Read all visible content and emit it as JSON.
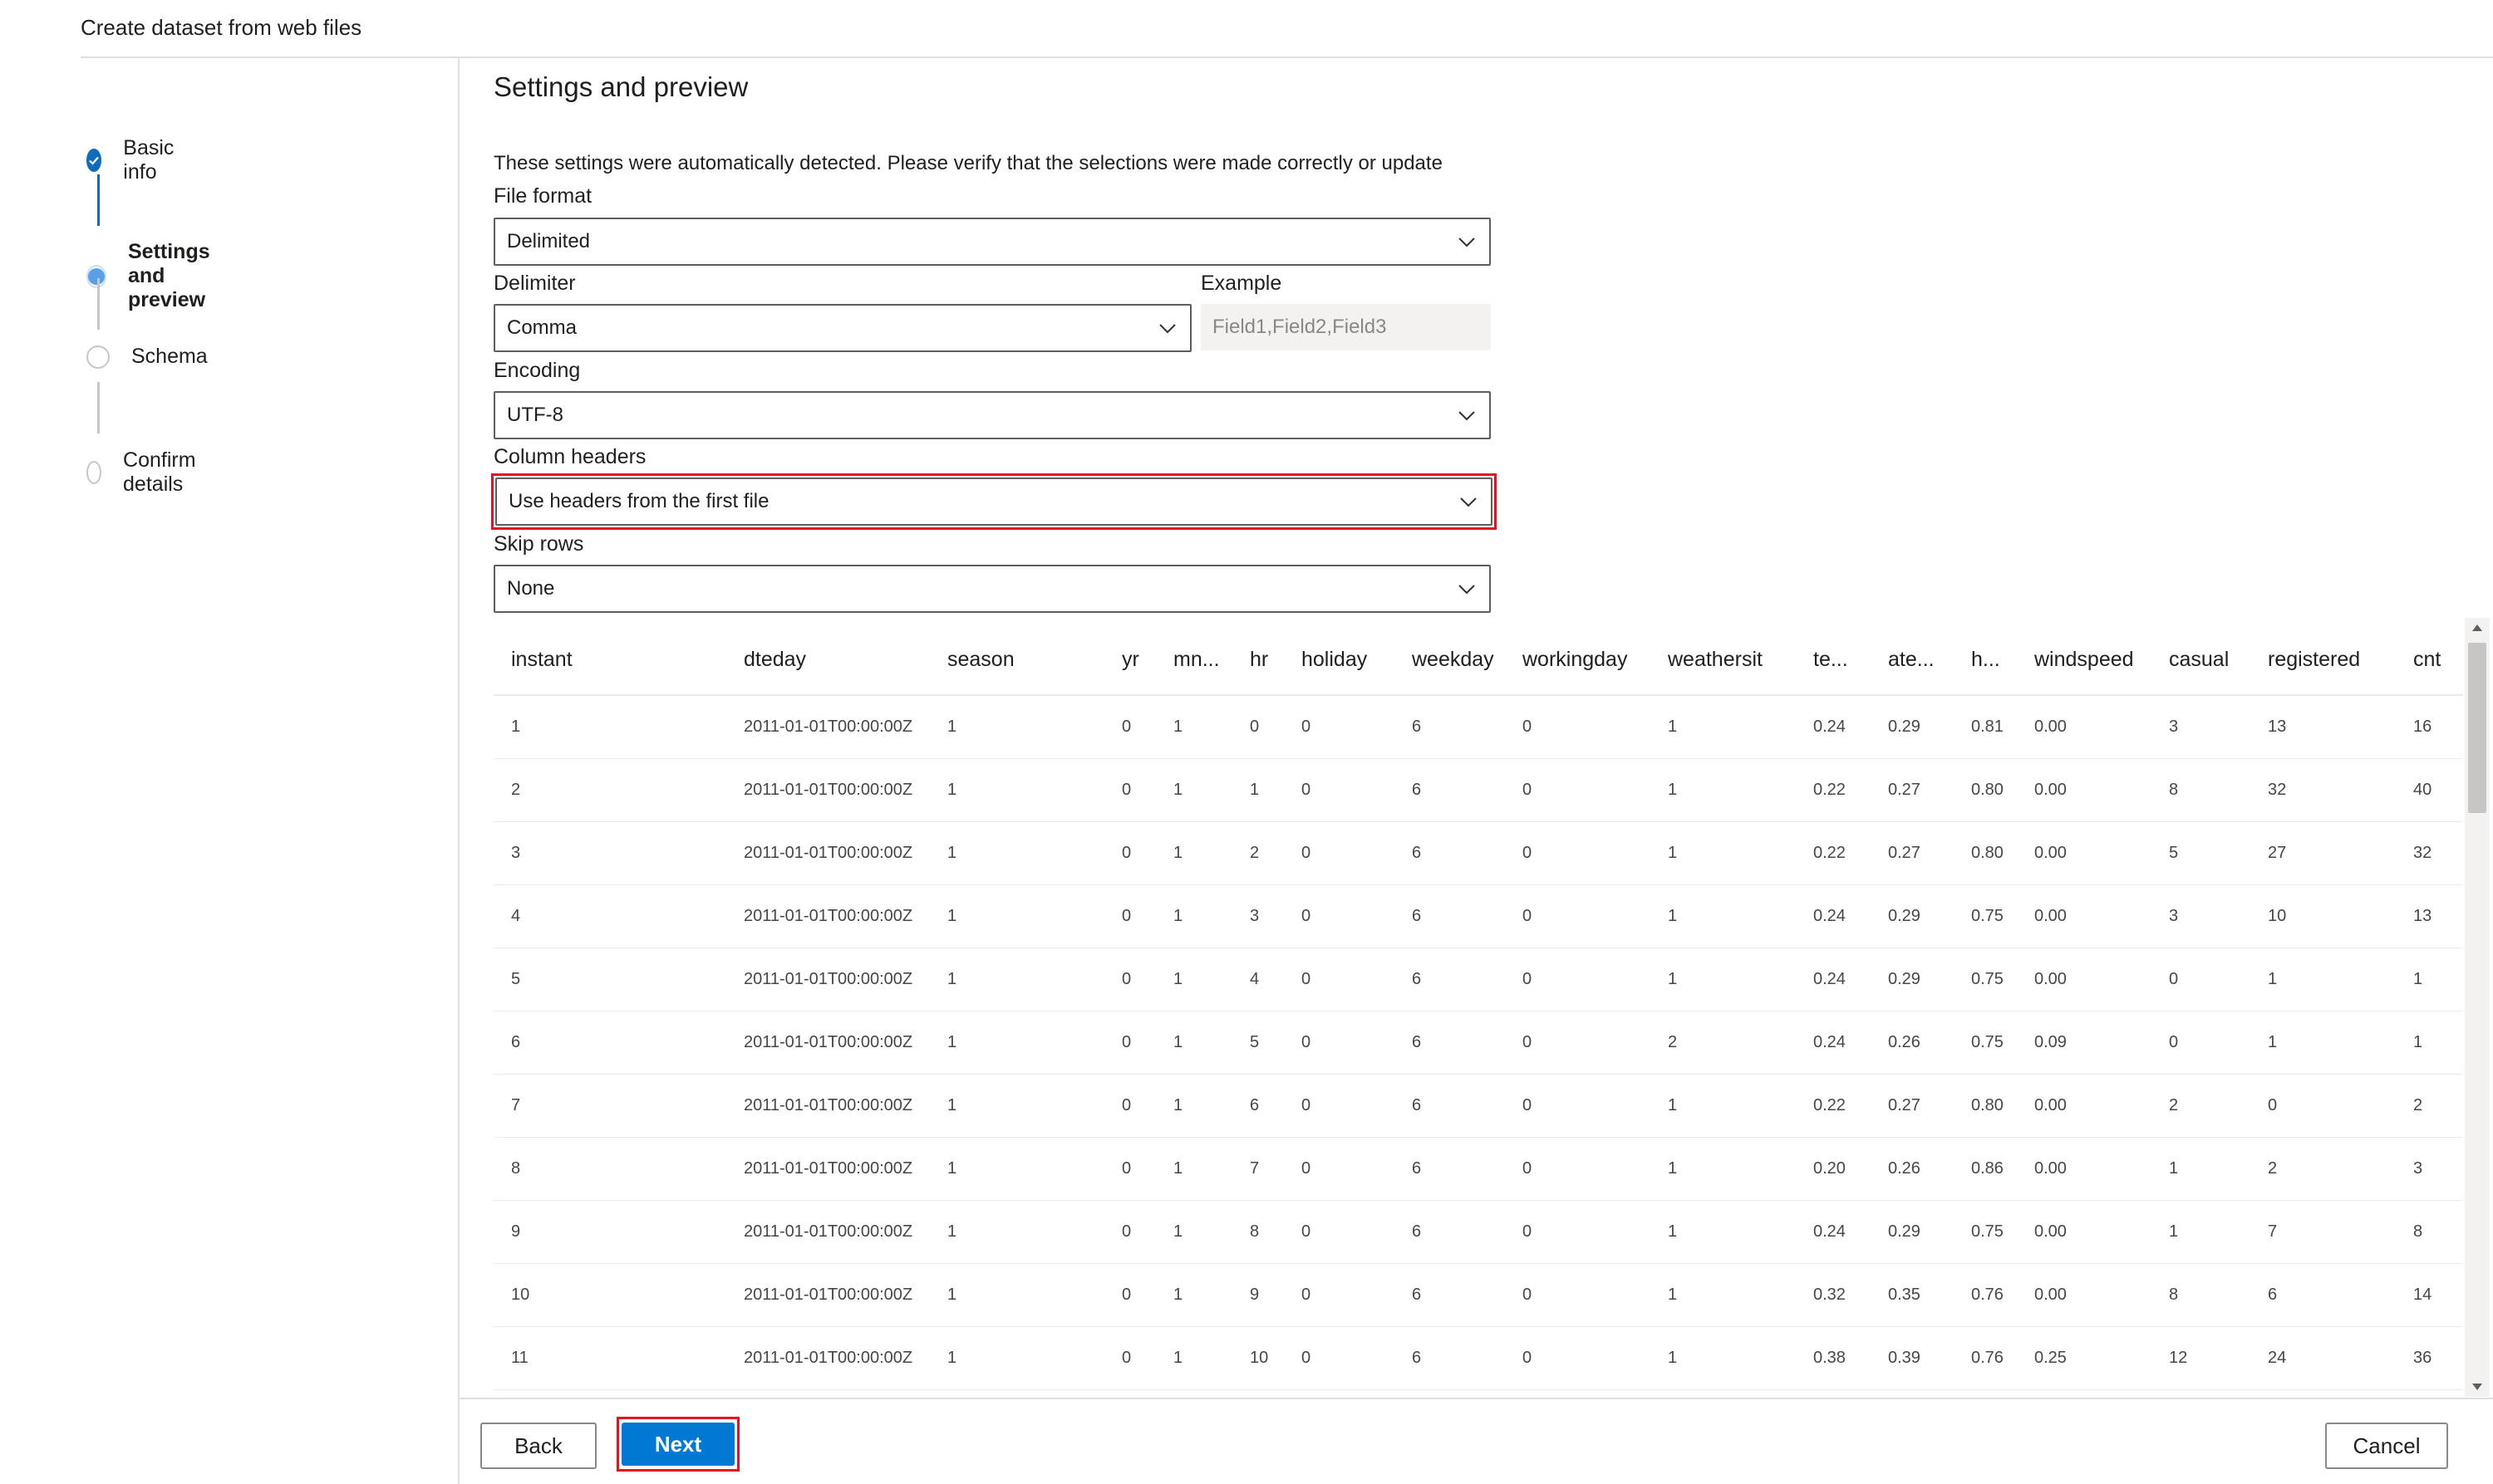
{
  "dialog": {
    "title": "Create dataset from web files"
  },
  "steps": [
    {
      "label": "Basic info",
      "state": "complete"
    },
    {
      "label": "Settings and preview",
      "state": "current"
    },
    {
      "label": "Schema",
      "state": "pending"
    },
    {
      "label": "Confirm details",
      "state": "pending"
    }
  ],
  "settings": {
    "title": "Settings and preview",
    "info": "These settings were automatically detected. Please verify that the selections were made correctly or update",
    "file_format": {
      "label": "File format",
      "value": "Delimited"
    },
    "delimiter": {
      "label": "Delimiter",
      "value": "Comma"
    },
    "example": {
      "label": "Example",
      "value": "Field1,Field2,Field3"
    },
    "encoding": {
      "label": "Encoding",
      "value": "UTF-8"
    },
    "column_headers": {
      "label": "Column headers",
      "value": "Use headers from the first file"
    },
    "skip_rows": {
      "label": "Skip rows",
      "value": "None"
    }
  },
  "preview": {
    "columns": [
      "instant",
      "dteday",
      "season",
      "yr",
      "mn...",
      "hr",
      "holiday",
      "weekday",
      "workingday",
      "weathersit",
      "te...",
      "ate...",
      "h...",
      "windspeed",
      "casual",
      "registered",
      "cnt"
    ],
    "rows": [
      [
        "1",
        "2011-01-01T00:00:00Z",
        "1",
        "0",
        "1",
        "0",
        "0",
        "6",
        "0",
        "1",
        "0.24",
        "0.29",
        "0.81",
        "0.00",
        "3",
        "13",
        "16"
      ],
      [
        "2",
        "2011-01-01T00:00:00Z",
        "1",
        "0",
        "1",
        "1",
        "0",
        "6",
        "0",
        "1",
        "0.22",
        "0.27",
        "0.80",
        "0.00",
        "8",
        "32",
        "40"
      ],
      [
        "3",
        "2011-01-01T00:00:00Z",
        "1",
        "0",
        "1",
        "2",
        "0",
        "6",
        "0",
        "1",
        "0.22",
        "0.27",
        "0.80",
        "0.00",
        "5",
        "27",
        "32"
      ],
      [
        "4",
        "2011-01-01T00:00:00Z",
        "1",
        "0",
        "1",
        "3",
        "0",
        "6",
        "0",
        "1",
        "0.24",
        "0.29",
        "0.75",
        "0.00",
        "3",
        "10",
        "13"
      ],
      [
        "5",
        "2011-01-01T00:00:00Z",
        "1",
        "0",
        "1",
        "4",
        "0",
        "6",
        "0",
        "1",
        "0.24",
        "0.29",
        "0.75",
        "0.00",
        "0",
        "1",
        "1"
      ],
      [
        "6",
        "2011-01-01T00:00:00Z",
        "1",
        "0",
        "1",
        "5",
        "0",
        "6",
        "0",
        "2",
        "0.24",
        "0.26",
        "0.75",
        "0.09",
        "0",
        "1",
        "1"
      ],
      [
        "7",
        "2011-01-01T00:00:00Z",
        "1",
        "0",
        "1",
        "6",
        "0",
        "6",
        "0",
        "1",
        "0.22",
        "0.27",
        "0.80",
        "0.00",
        "2",
        "0",
        "2"
      ],
      [
        "8",
        "2011-01-01T00:00:00Z",
        "1",
        "0",
        "1",
        "7",
        "0",
        "6",
        "0",
        "1",
        "0.20",
        "0.26",
        "0.86",
        "0.00",
        "1",
        "2",
        "3"
      ],
      [
        "9",
        "2011-01-01T00:00:00Z",
        "1",
        "0",
        "1",
        "8",
        "0",
        "6",
        "0",
        "1",
        "0.24",
        "0.29",
        "0.75",
        "0.00",
        "1",
        "7",
        "8"
      ],
      [
        "10",
        "2011-01-01T00:00:00Z",
        "1",
        "0",
        "1",
        "9",
        "0",
        "6",
        "0",
        "1",
        "0.32",
        "0.35",
        "0.76",
        "0.00",
        "8",
        "6",
        "14"
      ],
      [
        "11",
        "2011-01-01T00:00:00Z",
        "1",
        "0",
        "1",
        "10",
        "0",
        "6",
        "0",
        "1",
        "0.38",
        "0.39",
        "0.76",
        "0.25",
        "12",
        "24",
        "36"
      ]
    ]
  },
  "footer": {
    "back": "Back",
    "next": "Next",
    "cancel": "Cancel"
  },
  "colors": {
    "accent": "#0078d4",
    "highlight": "#e81123",
    "step_done": "#0f6cbd"
  }
}
